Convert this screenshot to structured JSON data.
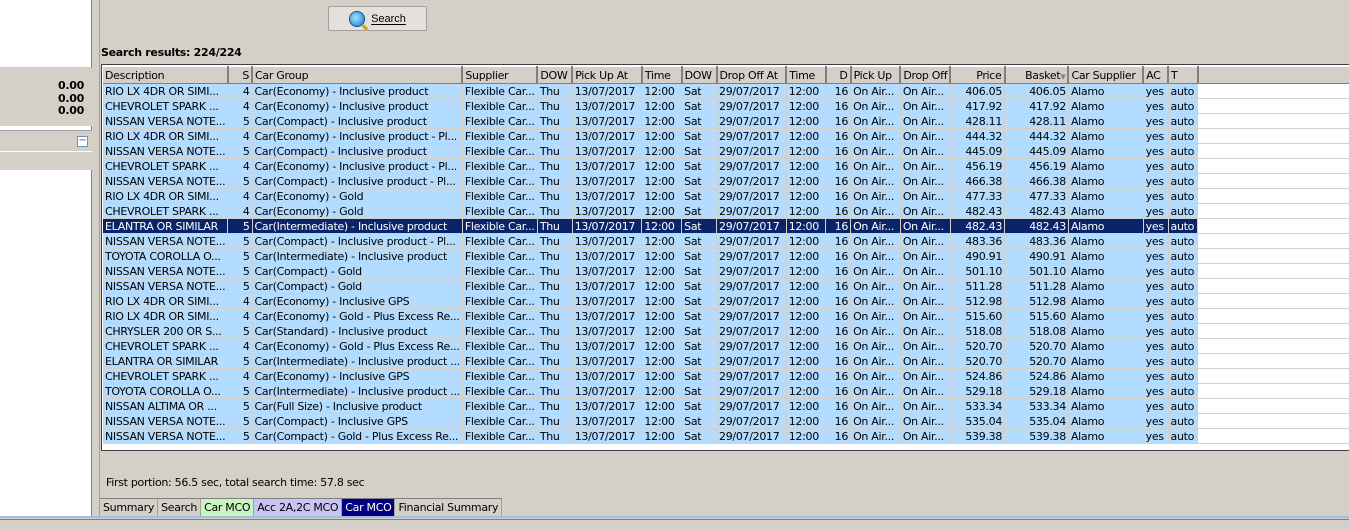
{
  "left_panel": {
    "values": [
      "0.00",
      "0.00",
      "0.00"
    ]
  },
  "toolbar": {
    "search_label": "Search"
  },
  "results": {
    "label": "Search results: 224/224"
  },
  "table": {
    "columns": [
      "Description",
      "S",
      "Car Group",
      "Supplier",
      "DOW",
      "Pick Up At",
      "Time",
      "DOW",
      "Drop Off At",
      "Time",
      "D",
      "Pick Up",
      "Drop Off",
      "Price",
      "Basket",
      "Car Supplier",
      "AC",
      "T"
    ],
    "sorted_column": "Basket",
    "selected_row": 9,
    "rows": [
      [
        "RIO LX 4DR OR SIMI...",
        "4",
        "Car(Economy) - Inclusive product",
        "Flexible Car...",
        "Thu",
        "13/07/2017",
        "12:00",
        "Sat",
        "29/07/2017",
        "12:00",
        "16",
        "On Air...",
        "On Air...",
        "406.05",
        "406.05",
        "Alamo",
        "yes",
        "auto"
      ],
      [
        "CHEVROLET SPARK ...",
        "4",
        "Car(Economy) - Inclusive product",
        "Flexible Car...",
        "Thu",
        "13/07/2017",
        "12:00",
        "Sat",
        "29/07/2017",
        "12:00",
        "16",
        "On Air...",
        "On Air...",
        "417.92",
        "417.92",
        "Alamo",
        "yes",
        "auto"
      ],
      [
        "NISSAN VERSA NOTE...",
        "5",
        "Car(Compact) - Inclusive product",
        "Flexible Car...",
        "Thu",
        "13/07/2017",
        "12:00",
        "Sat",
        "29/07/2017",
        "12:00",
        "16",
        "On Air...",
        "On Air...",
        "428.11",
        "428.11",
        "Alamo",
        "yes",
        "auto"
      ],
      [
        "RIO LX 4DR OR SIMI...",
        "4",
        "Car(Economy) - Inclusive product - Pl...",
        "Flexible Car...",
        "Thu",
        "13/07/2017",
        "12:00",
        "Sat",
        "29/07/2017",
        "12:00",
        "16",
        "On Air...",
        "On Air...",
        "444.32",
        "444.32",
        "Alamo",
        "yes",
        "auto"
      ],
      [
        "NISSAN VERSA NOTE...",
        "5",
        "Car(Compact) - Inclusive product",
        "Flexible Car...",
        "Thu",
        "13/07/2017",
        "12:00",
        "Sat",
        "29/07/2017",
        "12:00",
        "16",
        "On Air...",
        "On Air...",
        "445.09",
        "445.09",
        "Alamo",
        "yes",
        "auto"
      ],
      [
        "CHEVROLET SPARK ...",
        "4",
        "Car(Economy) - Inclusive product - Pl...",
        "Flexible Car...",
        "Thu",
        "13/07/2017",
        "12:00",
        "Sat",
        "29/07/2017",
        "12:00",
        "16",
        "On Air...",
        "On Air...",
        "456.19",
        "456.19",
        "Alamo",
        "yes",
        "auto"
      ],
      [
        "NISSAN VERSA NOTE...",
        "5",
        "Car(Compact) - Inclusive product - Pl...",
        "Flexible Car...",
        "Thu",
        "13/07/2017",
        "12:00",
        "Sat",
        "29/07/2017",
        "12:00",
        "16",
        "On Air...",
        "On Air...",
        "466.38",
        "466.38",
        "Alamo",
        "yes",
        "auto"
      ],
      [
        "RIO LX 4DR OR SIMI...",
        "4",
        "Car(Economy) - Gold",
        "Flexible Car...",
        "Thu",
        "13/07/2017",
        "12:00",
        "Sat",
        "29/07/2017",
        "12:00",
        "16",
        "On Air...",
        "On Air...",
        "477.33",
        "477.33",
        "Alamo",
        "yes",
        "auto"
      ],
      [
        "CHEVROLET SPARK ...",
        "4",
        "Car(Economy) - Gold",
        "Flexible Car...",
        "Thu",
        "13/07/2017",
        "12:00",
        "Sat",
        "29/07/2017",
        "12:00",
        "16",
        "On Air...",
        "On Air...",
        "482.43",
        "482.43",
        "Alamo",
        "yes",
        "auto"
      ],
      [
        "ELANTRA OR SIMILAR",
        "5",
        "Car(Intermediate) - Inclusive product",
        "Flexible Car...",
        "Thu",
        "13/07/2017",
        "12:00",
        "Sat",
        "29/07/2017",
        "12:00",
        "16",
        "On Air...",
        "On Air...",
        "482.43",
        "482.43",
        "Alamo",
        "yes",
        "auto"
      ],
      [
        "NISSAN VERSA NOTE...",
        "5",
        "Car(Compact) - Inclusive product - Pl...",
        "Flexible Car...",
        "Thu",
        "13/07/2017",
        "12:00",
        "Sat",
        "29/07/2017",
        "12:00",
        "16",
        "On Air...",
        "On Air...",
        "483.36",
        "483.36",
        "Alamo",
        "yes",
        "auto"
      ],
      [
        "TOYOTA COROLLA O...",
        "5",
        "Car(Intermediate) - Inclusive product",
        "Flexible Car...",
        "Thu",
        "13/07/2017",
        "12:00",
        "Sat",
        "29/07/2017",
        "12:00",
        "16",
        "On Air...",
        "On Air...",
        "490.91",
        "490.91",
        "Alamo",
        "yes",
        "auto"
      ],
      [
        "NISSAN VERSA NOTE...",
        "5",
        "Car(Compact) - Gold",
        "Flexible Car...",
        "Thu",
        "13/07/2017",
        "12:00",
        "Sat",
        "29/07/2017",
        "12:00",
        "16",
        "On Air...",
        "On Air...",
        "501.10",
        "501.10",
        "Alamo",
        "yes",
        "auto"
      ],
      [
        "NISSAN VERSA NOTE...",
        "5",
        "Car(Compact) - Gold",
        "Flexible Car...",
        "Thu",
        "13/07/2017",
        "12:00",
        "Sat",
        "29/07/2017",
        "12:00",
        "16",
        "On Air...",
        "On Air...",
        "511.28",
        "511.28",
        "Alamo",
        "yes",
        "auto"
      ],
      [
        "RIO LX 4DR OR SIMI...",
        "4",
        "Car(Economy) - Inclusive GPS",
        "Flexible Car...",
        "Thu",
        "13/07/2017",
        "12:00",
        "Sat",
        "29/07/2017",
        "12:00",
        "16",
        "On Air...",
        "On Air...",
        "512.98",
        "512.98",
        "Alamo",
        "yes",
        "auto"
      ],
      [
        "RIO LX 4DR OR SIMI...",
        "4",
        "Car(Economy) - Gold - Plus Excess Re...",
        "Flexible Car...",
        "Thu",
        "13/07/2017",
        "12:00",
        "Sat",
        "29/07/2017",
        "12:00",
        "16",
        "On Air...",
        "On Air...",
        "515.60",
        "515.60",
        "Alamo",
        "yes",
        "auto"
      ],
      [
        "CHRYSLER 200 OR S...",
        "5",
        "Car(Standard) - Inclusive product",
        "Flexible Car...",
        "Thu",
        "13/07/2017",
        "12:00",
        "Sat",
        "29/07/2017",
        "12:00",
        "16",
        "On Air...",
        "On Air...",
        "518.08",
        "518.08",
        "Alamo",
        "yes",
        "auto"
      ],
      [
        "CHEVROLET SPARK ...",
        "4",
        "Car(Economy) - Gold - Plus Excess Re...",
        "Flexible Car...",
        "Thu",
        "13/07/2017",
        "12:00",
        "Sat",
        "29/07/2017",
        "12:00",
        "16",
        "On Air...",
        "On Air...",
        "520.70",
        "520.70",
        "Alamo",
        "yes",
        "auto"
      ],
      [
        "ELANTRA OR SIMILAR",
        "5",
        "Car(Intermediate) - Inclusive product ...",
        "Flexible Car...",
        "Thu",
        "13/07/2017",
        "12:00",
        "Sat",
        "29/07/2017",
        "12:00",
        "16",
        "On Air...",
        "On Air...",
        "520.70",
        "520.70",
        "Alamo",
        "yes",
        "auto"
      ],
      [
        "CHEVROLET SPARK ...",
        "4",
        "Car(Economy) - Inclusive GPS",
        "Flexible Car...",
        "Thu",
        "13/07/2017",
        "12:00",
        "Sat",
        "29/07/2017",
        "12:00",
        "16",
        "On Air...",
        "On Air...",
        "524.86",
        "524.86",
        "Alamo",
        "yes",
        "auto"
      ],
      [
        "TOYOTA COROLLA O...",
        "5",
        "Car(Intermediate) - Inclusive product ...",
        "Flexible Car...",
        "Thu",
        "13/07/2017",
        "12:00",
        "Sat",
        "29/07/2017",
        "12:00",
        "16",
        "On Air...",
        "On Air...",
        "529.18",
        "529.18",
        "Alamo",
        "yes",
        "auto"
      ],
      [
        "NISSAN ALTIMA OR ...",
        "5",
        "Car(Full Size) - Inclusive product",
        "Flexible Car...",
        "Thu",
        "13/07/2017",
        "12:00",
        "Sat",
        "29/07/2017",
        "12:00",
        "16",
        "On Air...",
        "On Air...",
        "533.34",
        "533.34",
        "Alamo",
        "yes",
        "auto"
      ],
      [
        "NISSAN VERSA NOTE...",
        "5",
        "Car(Compact) - Inclusive GPS",
        "Flexible Car...",
        "Thu",
        "13/07/2017",
        "12:00",
        "Sat",
        "29/07/2017",
        "12:00",
        "16",
        "On Air...",
        "On Air...",
        "535.04",
        "535.04",
        "Alamo",
        "yes",
        "auto"
      ],
      [
        "NISSAN VERSA NOTE...",
        "5",
        "Car(Compact) - Gold - Plus Excess Re...",
        "Flexible Car...",
        "Thu",
        "13/07/2017",
        "12:00",
        "Sat",
        "29/07/2017",
        "12:00",
        "16",
        "On Air...",
        "On Air...",
        "539.38",
        "539.38",
        "Alamo",
        "yes",
        "auto"
      ]
    ]
  },
  "status": {
    "text": "First portion: 56.5 sec, total search time: 57.8 sec"
  },
  "tabs": [
    {
      "label": "Summary",
      "color": "#d4d0c8",
      "text": "#000000"
    },
    {
      "label": "Search",
      "color": "#d4d0c8",
      "text": "#000000"
    },
    {
      "label": "Car MCO",
      "color": "#c8f5c0",
      "text": "#000000"
    },
    {
      "label": "Acc 2A,2C MCO",
      "color": "#c8c4f5",
      "text": "#000000"
    },
    {
      "label": "Car MCO",
      "color": "#000080",
      "text": "#ffffff"
    },
    {
      "label": "Financial Summary",
      "color": "#d4d0c8",
      "text": "#000000"
    }
  ]
}
